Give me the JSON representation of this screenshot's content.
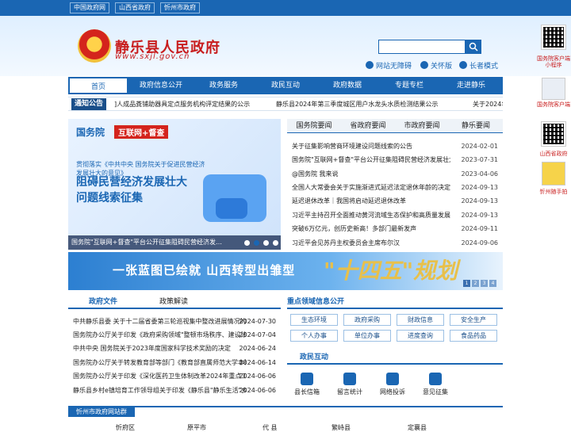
{
  "top_links": [
    "中国政府网",
    "山西省政府",
    "忻州市政府"
  ],
  "site": {
    "title": "静乐县人民政府",
    "domain": "www.sxjl.gov.cn"
  },
  "utilities": [
    "网站无障碍",
    "关怀版",
    "长者模式"
  ],
  "nav": [
    "首页",
    "政府信息公开",
    "政务服务",
    "政民互动",
    "政府数据",
    "专题专栏",
    "走进静乐"
  ],
  "notice": {
    "label": "通知公告",
    "items": [
      "]人成品粪铺助器具定点服务机构评定结果的公示",
      "静乐县2024年第三季度城区用户水龙头水质检测结果公示",
      "关于2024年"
    ]
  },
  "carousel": {
    "brand": "国务院",
    "tag": "互联网+督查",
    "subtitle": "贯彻落实《中共中央 国务院关于促进民营经济发展壮大的意见》",
    "headline": "阻碍民营经济发展壮大问题线索征集",
    "caption": "国务院\"互联网+督查\"平台公开征集阻碍民营经济发…"
  },
  "news": {
    "tabs": [
      "国务院要闻",
      "省政府要闻",
      "市政府要闻",
      "静乐要闻"
    ],
    "items": [
      {
        "title": "关于征集影响营商环境建设问题线索的公告",
        "date": "2024-02-01"
      },
      {
        "title": "国务院\"互联网+督查\"平台公开征集阻碍民营经济发展壮大问题...",
        "date": "2023-07-31"
      },
      {
        "title": "@国务院 我来说",
        "date": "2023-04-06"
      },
      {
        "title": "全国人大常委会关于实施渐进式延迟法定退休年龄的决定",
        "date": "2024-09-13"
      },
      {
        "title": "延迟退休改革｜我国将启动延迟退休改革",
        "date": "2024-09-13"
      },
      {
        "title": "习近平主持召开全面推动黄河流域生态保护和高质量发展座谈会",
        "date": "2024-09-13"
      },
      {
        "title": "突破6万亿元，创历史新高！多部门最新发声",
        "date": "2024-09-11"
      },
      {
        "title": "习近平会见苏丹主权委员会主席布尔汉",
        "date": "2024-09-06"
      }
    ]
  },
  "banner": {
    "text": "一张蓝图已绘就 山西转型出雏型",
    "big": "\"十四五\"规划",
    "pages": [
      "1",
      "2",
      "3",
      "4"
    ]
  },
  "policy": {
    "tabs": [
      "政府文件",
      "政策解读"
    ],
    "items": [
      {
        "title": "中共静乐县委 关于十二届省委第三轮巡视集中整改进展情况的通报",
        "date": "2024-07-30"
      },
      {
        "title": "国务院办公厅关于印发《政府采购领域\"整顿市场秩序、建设法...",
        "date": "2024-07-04"
      },
      {
        "title": "中共中央 国务院关于2023年度国家科学技术奖励的决定",
        "date": "2024-06-24"
      },
      {
        "title": "国务院办公厅关于转发教育部等部门《教育部直属师范大学本研...",
        "date": "2024-06-14"
      },
      {
        "title": "国务院办公厅关于印发《深化医药卫生体制改革2024年重点工作...",
        "date": "2024-06-06"
      },
      {
        "title": "静乐县乡村e镇培育工作领导组关于印发《静乐县\"静乐生活\"乡...",
        "date": "2024-06-06"
      }
    ]
  },
  "key_areas": {
    "title": "重点领域信息公开",
    "buttons": [
      "生态环境",
      "政府采购",
      "财政信息",
      "安全生产",
      "个人办事",
      "单位办事",
      "进度查询",
      "食品药品"
    ]
  },
  "interaction": {
    "title": "政民互动",
    "items": [
      "县长信箱",
      "留言统计",
      "网络投诉",
      "意见征集"
    ]
  },
  "footer": {
    "title": "忻州市政府网站群",
    "counties": [
      "忻府区",
      "原平市",
      "代 县",
      "繁峙县",
      "定襄县"
    ]
  },
  "side": {
    "labels": [
      "国务院客户端小程序",
      "国务院客户端",
      "山西省政府",
      "忻州随手拍"
    ]
  }
}
